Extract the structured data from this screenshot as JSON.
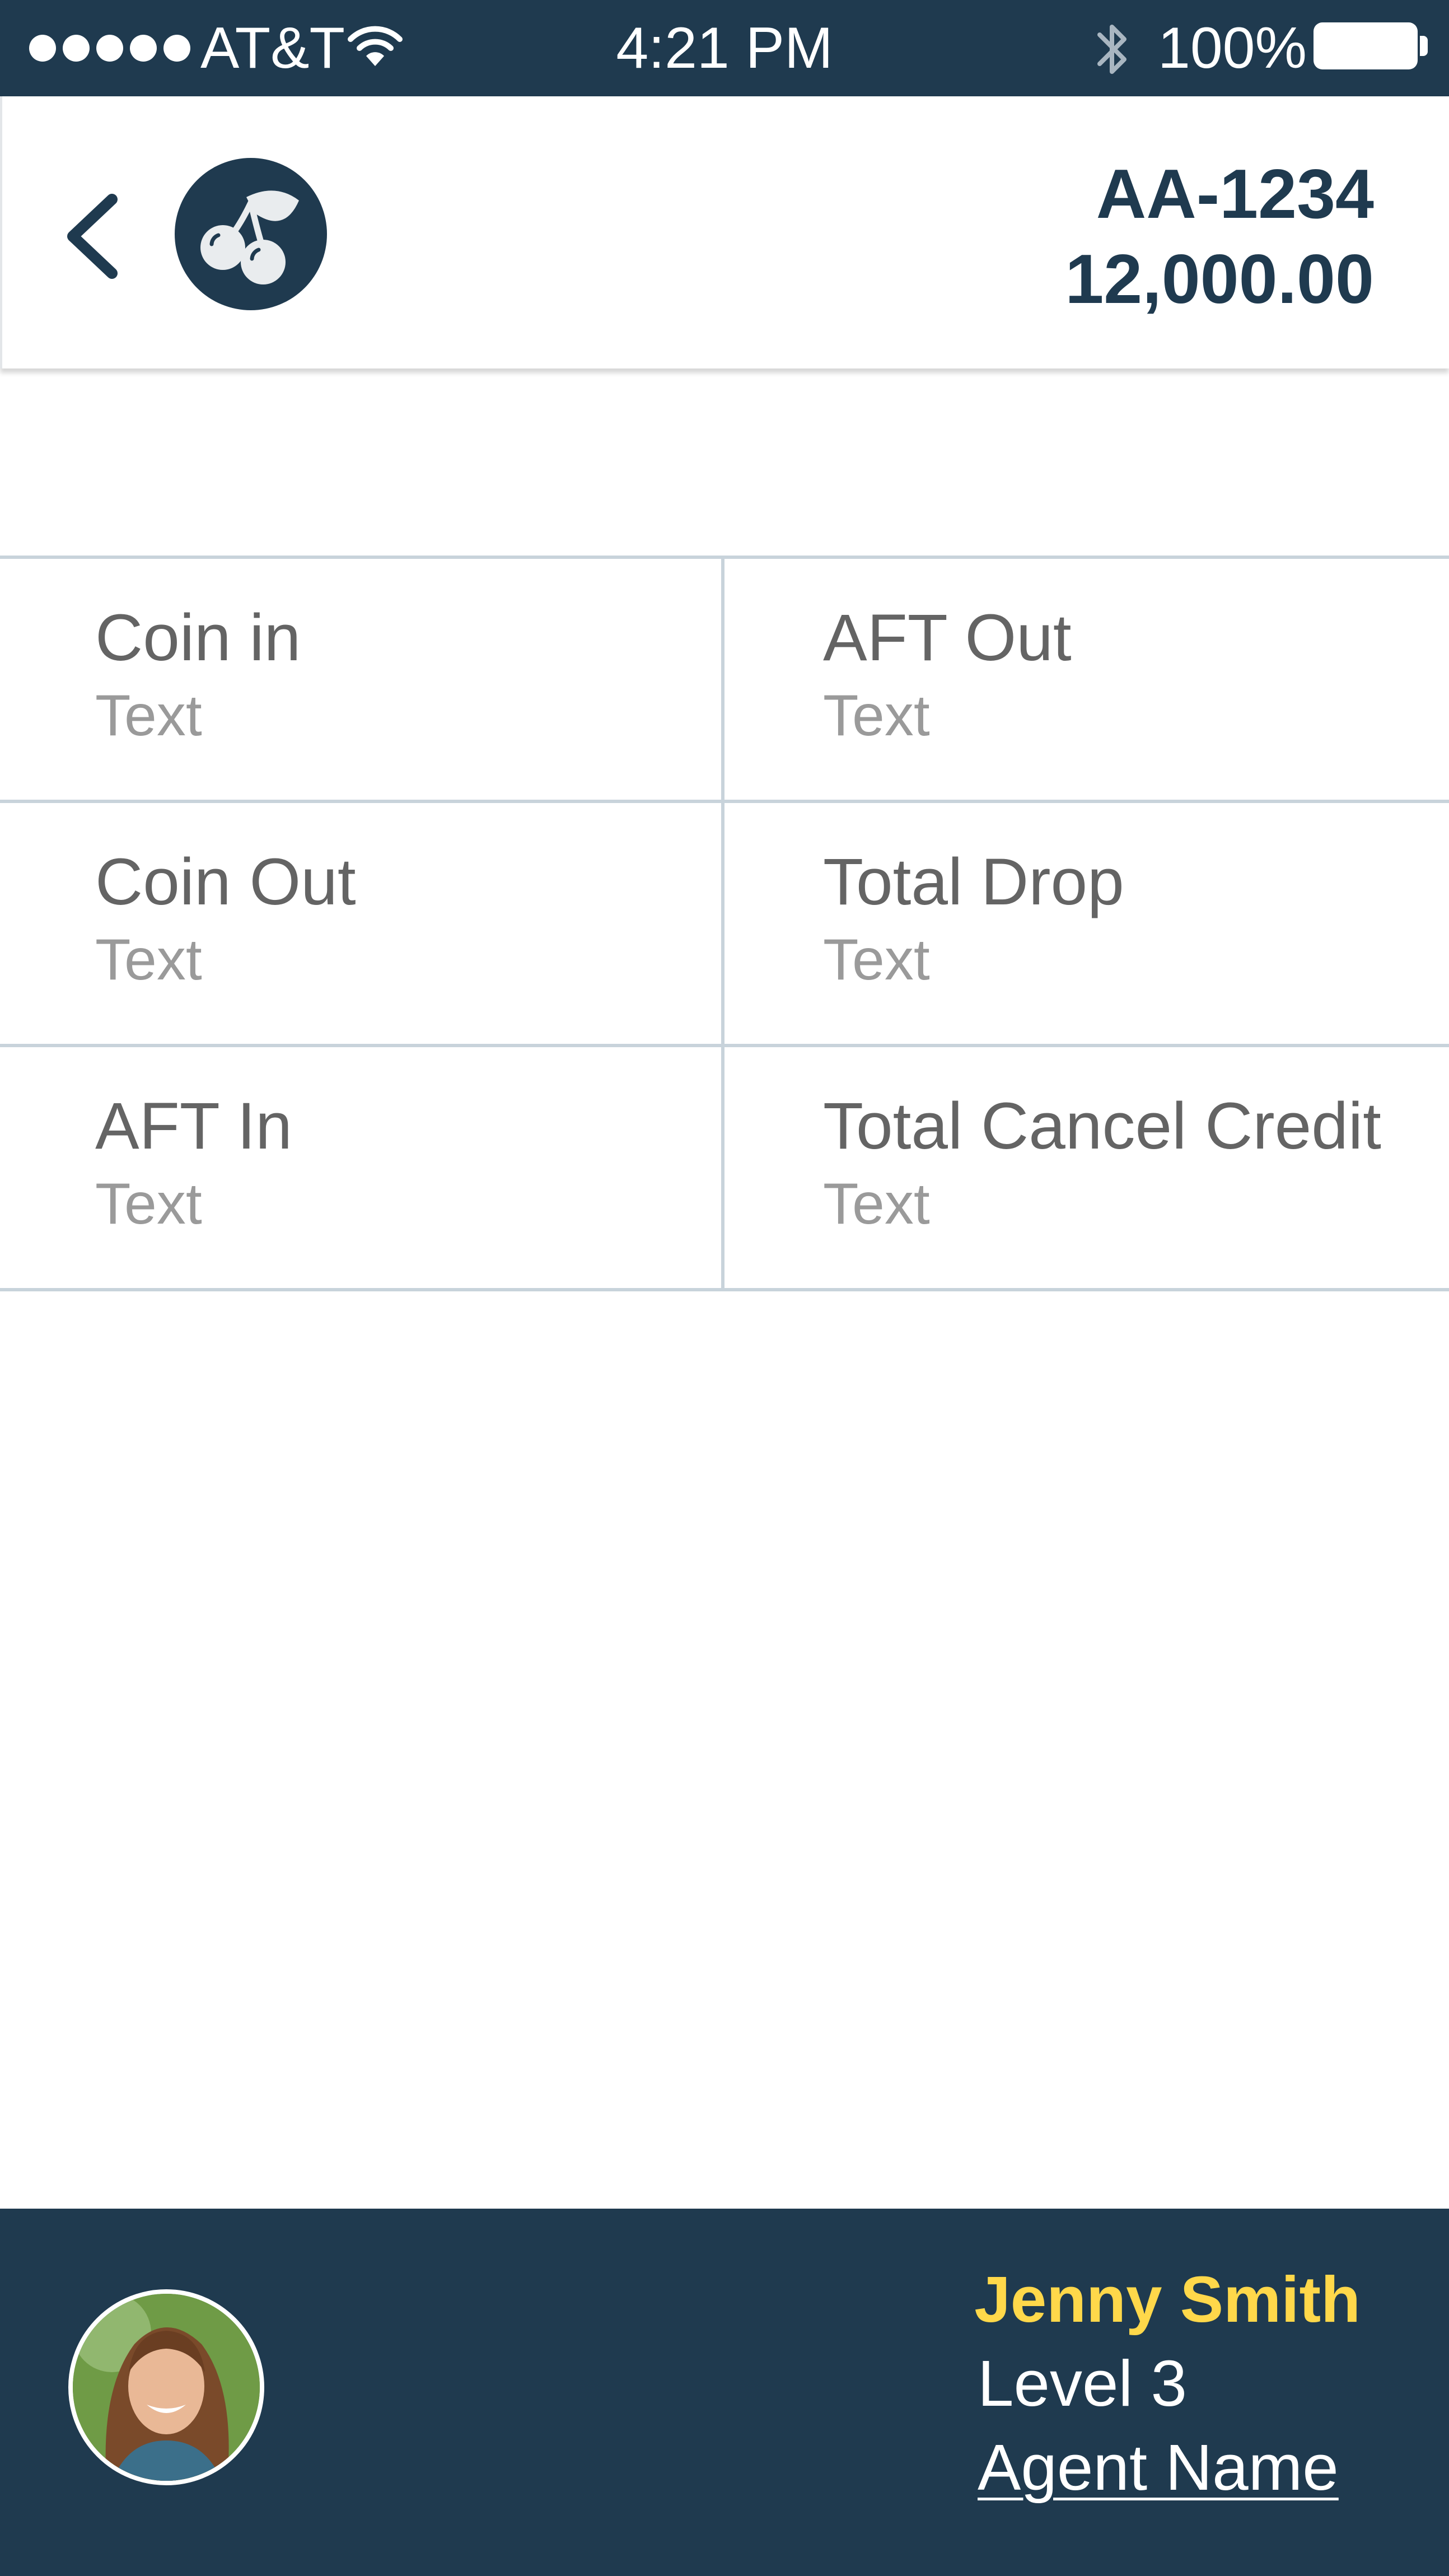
{
  "status_bar": {
    "carrier": "AT&T",
    "time": "4:21 PM",
    "battery": "100%",
    "icons": [
      "signal-dots-icon",
      "wifi-icon",
      "bluetooth-icon",
      "battery-icon"
    ]
  },
  "header": {
    "machine_id": "AA-1234",
    "amount": "12,000.00",
    "icons": [
      "chevron-left-icon",
      "cherry-icon"
    ]
  },
  "grid": {
    "cells": [
      {
        "label": "Coin in",
        "value": "Text"
      },
      {
        "label": "AFT Out",
        "value": "Text"
      },
      {
        "label": "Coin Out",
        "value": "Text"
      },
      {
        "label": "Total Drop",
        "value": "Text"
      },
      {
        "label": "AFT In",
        "value": "Text"
      },
      {
        "label": "Total Cancel Credit",
        "value": "Text"
      }
    ]
  },
  "footer": {
    "name": "Jenny Smith",
    "level": "Level 3",
    "agent_link": "Agent Name"
  },
  "colors": {
    "primary": "#1f3a4f",
    "accent": "#ffd84a",
    "divider": "#c8d3db"
  }
}
